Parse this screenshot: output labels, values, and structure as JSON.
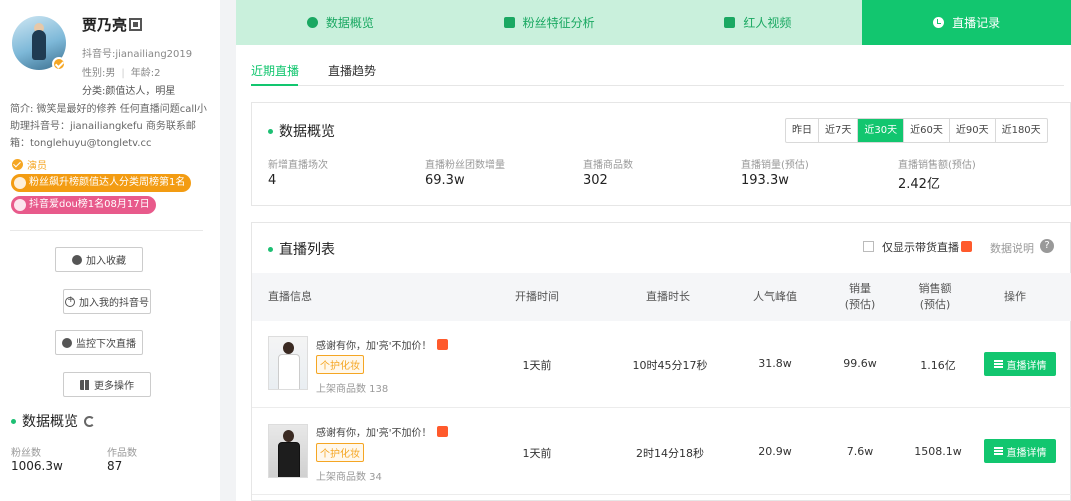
{
  "profile": {
    "name": "贾乃亮",
    "douyin_id": "抖音号:jianailiang2019",
    "gender": "性别:男",
    "age": "年龄:2",
    "category": "分类:颜值达人，明星",
    "bio": "简介: 微笑是最好的修养 任何直播问题call小助理抖音号：jianailiangkefu 商务联系邮箱：tonglehuyu@tongletv.cc",
    "tag_actor": "演员",
    "badge_rank1": "粉丝飙升榜颜值达人分类周榜第1名",
    "badge_rank2": "抖音爱dou榜1名08月17日"
  },
  "sidebar_buttons": {
    "favorite": "加入收藏",
    "add_my_douyin": "加入我的抖音号",
    "monitor_next_live": "监控下次直播",
    "more_actions": "更多操作"
  },
  "sidebar_overview": {
    "title": "数据概览",
    "fans_label": "粉丝数",
    "fans_value": "1006.3w",
    "works_label": "作品数",
    "works_value": "87"
  },
  "tabs": [
    {
      "label": "数据概览"
    },
    {
      "label": "粉丝特征分析"
    },
    {
      "label": "红人视频"
    },
    {
      "label": "直播记录"
    }
  ],
  "subtabs": {
    "recent": "近期直播",
    "trend": "直播趋势"
  },
  "overview": {
    "title": "数据概览",
    "ranges": [
      "昨日",
      "近7天",
      "近30天",
      "近60天",
      "近90天",
      "近180天"
    ],
    "selected_range": "近30天",
    "metrics": [
      {
        "label": "新增直播场次",
        "value": "4"
      },
      {
        "label": "直播粉丝团数增量",
        "value": "69.3w"
      },
      {
        "label": "直播商品数",
        "value": "302"
      },
      {
        "label": "直播销量(预估)",
        "value": "193.3w"
      },
      {
        "label": "直播销售额(预估)",
        "value": "2.42亿"
      }
    ]
  },
  "live_list": {
    "title": "直播列表",
    "only_goods_label": "仅显示带货直播",
    "help_label": "数据说明",
    "help_icon": "?",
    "headers": {
      "info": "直播信息",
      "start": "开播时间",
      "duration": "直播时长",
      "peak": "人气峰值",
      "sales_1": "销量",
      "sales_2": "(预估)",
      "revenue_1": "销售额",
      "revenue_2": "(预估)",
      "action": "操作"
    },
    "rows": [
      {
        "title": "感谢有你，加'亮'不加价！",
        "tag": "个护化妆",
        "goods": "上架商品数 138",
        "start": "1天前",
        "duration": "10时45分17秒",
        "peak": "31.8w",
        "sales": "99.6w",
        "revenue": "1.16亿",
        "action": "直播详情"
      },
      {
        "title": "感谢有你，加'亮'不加价！",
        "tag": "个护化妆",
        "goods": "上架商品数 34",
        "start": "1天前",
        "duration": "2时14分18秒",
        "peak": "20.9w",
        "sales": "7.6w",
        "revenue": "1508.1w",
        "action": "直播详情"
      }
    ]
  }
}
